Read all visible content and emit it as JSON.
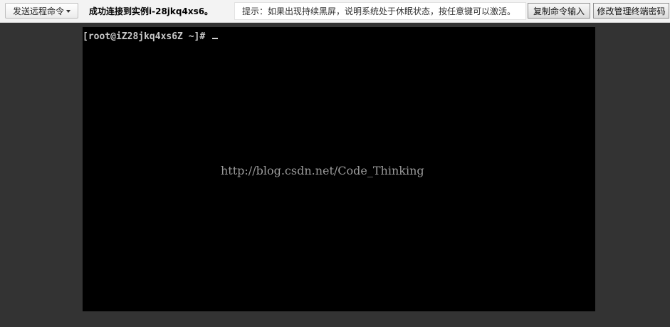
{
  "toolbar": {
    "send_command_label": "发送远程命令",
    "connection_status": "成功连接到实例i-28jkq4xs6。",
    "hint": "提示：如果出现持续黑屏，说明系统处于休眠状态，按任意键可以激活。",
    "copy_input_label": "复制命令输入",
    "change_password_label": "修改管理终端密码"
  },
  "terminal": {
    "prompt": "[root@iZ28jkq4xs6Z ~]# ",
    "watermark": "http://blog.csdn.net/Code_Thinking"
  },
  "colors": {
    "terminal_bg": "#000000",
    "page_bg": "#333333",
    "terminal_text": "#c9c9c9"
  }
}
